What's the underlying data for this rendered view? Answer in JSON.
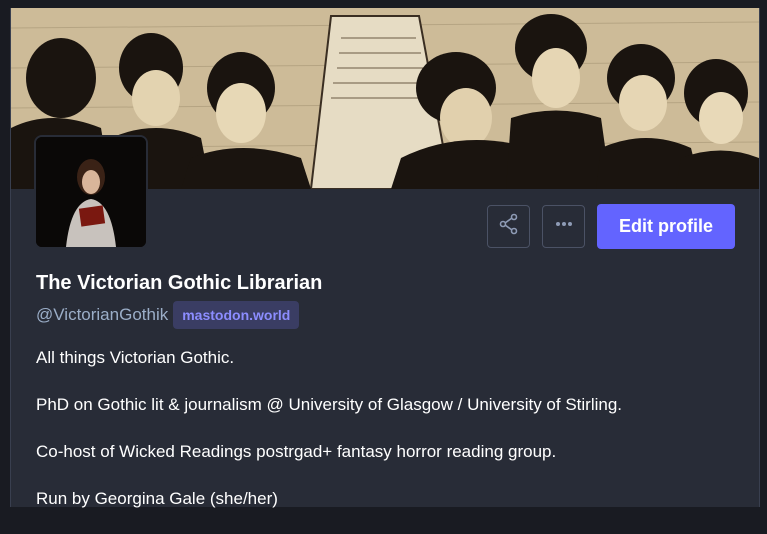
{
  "profile": {
    "display_name": "The Victorian Gothic Librarian",
    "handle": "@VictorianGothik",
    "domain": "mastodon.world"
  },
  "header_image": {
    "description": "Victorian engraving of group of men",
    "icon": "engraving-header"
  },
  "avatar": {
    "icon": "woman-reading-book-avatar"
  },
  "actions": {
    "share_icon": "share-icon",
    "more_icon": "more-options-icon",
    "edit_label": "Edit profile"
  },
  "bio": [
    "All things Victorian Gothic.",
    "PhD on Gothic lit & journalism @ University of Glasgow / University of Stirling.",
    "Co-host of Wicked Readings postrgad+ fantasy horror reading group.",
    "Run by Georgina Gale (she/her)"
  ],
  "colors": {
    "accent": "#6364ff",
    "background": "#282c37",
    "muted": "#9baec8"
  }
}
